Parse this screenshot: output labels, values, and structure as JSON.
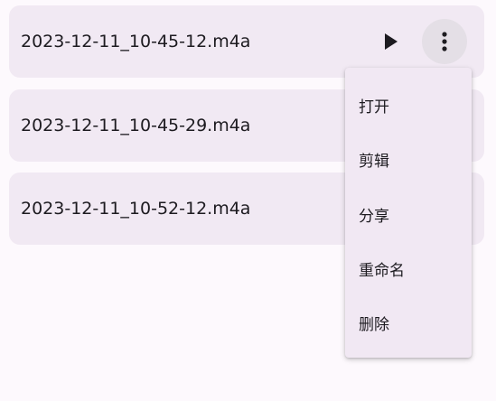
{
  "files": [
    {
      "name": "2023-12-11_10-45-12.m4a"
    },
    {
      "name": "2023-12-11_10-45-29.m4a"
    },
    {
      "name": "2023-12-11_10-52-12.m4a"
    }
  ],
  "icons": {
    "play": "play-icon",
    "more": "more-vert-icon"
  },
  "menu": {
    "items": [
      {
        "label": "打开"
      },
      {
        "label": "剪辑"
      },
      {
        "label": "分享"
      },
      {
        "label": "重命名"
      },
      {
        "label": "删除"
      }
    ]
  },
  "colors": {
    "background": "#fdf9fd",
    "card": "#f1e9f3",
    "menu": "#f1e8f3",
    "more_button_highlight": "#e4dfe6",
    "text": "#1d1b20"
  }
}
